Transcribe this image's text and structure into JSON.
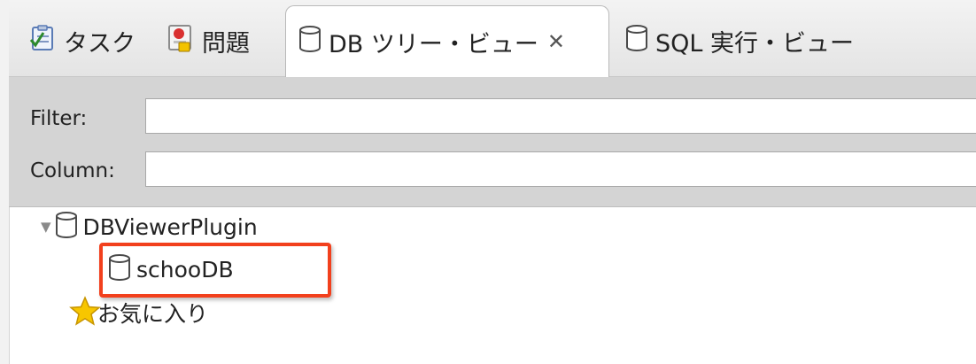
{
  "tabs": [
    {
      "label": "タスク",
      "icon": "tasks-icon"
    },
    {
      "label": "問題",
      "icon": "problems-icon"
    },
    {
      "label": "DB ツリー・ビュー",
      "icon": "database-icon",
      "active": true,
      "close_icon": "close-icon"
    },
    {
      "label": "SQL 実行・ビュー",
      "icon": "database-icon"
    }
  ],
  "filter": {
    "filter_label": "Filter:",
    "filter_value": "",
    "column_label": "Column:",
    "column_value": ""
  },
  "tree": {
    "root": {
      "label": "DBViewerPlugin",
      "expanded": true,
      "icon": "database-icon"
    },
    "child": {
      "label": "schooDB",
      "icon": "database-icon",
      "highlighted": true
    },
    "favorites": {
      "label": "お気に入り",
      "icon": "star-icon"
    }
  },
  "colors": {
    "highlight": "#f2401d",
    "panel": "#d4d4d4",
    "star": "#f7c600"
  }
}
